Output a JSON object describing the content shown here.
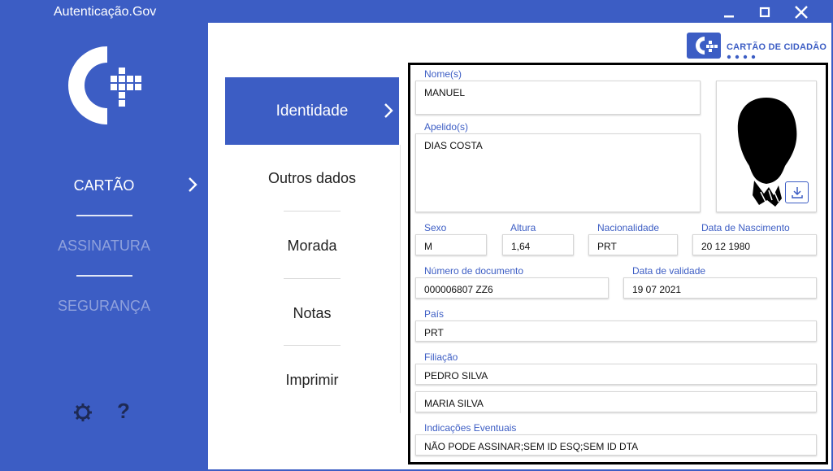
{
  "window": {
    "title": "Autenticação.Gov",
    "minimize_icon": "minimize-icon",
    "maximize_icon": "maximize-icon",
    "close_icon": "close-icon"
  },
  "colors": {
    "brand_blue": "#3c5dc4",
    "inactive_nav": "#8fa1dc",
    "label_blue": "#3c5dc4"
  },
  "sidebar": {
    "logo_icon": "cartao-cidadao-logo",
    "items": [
      {
        "label": "CARTÃO",
        "active": true
      },
      {
        "label": "ASSINATURA",
        "active": false
      },
      {
        "label": "SEGURANÇA",
        "active": false
      }
    ],
    "settings_icon": "gear-icon",
    "help_label": "?"
  },
  "brand": {
    "text": "CARTÃO DE CIDADÃO"
  },
  "subnav": {
    "items": [
      {
        "label": "Identidade",
        "active": true
      },
      {
        "label": "Outros dados"
      },
      {
        "label": "Morada"
      },
      {
        "label": "Notas"
      },
      {
        "label": "Imprimir"
      }
    ]
  },
  "card": {
    "nomes": {
      "label": "Nome(s)",
      "value": "MANUEL"
    },
    "apelidos": {
      "label": "Apelido(s)",
      "value": "DIAS COSTA"
    },
    "sexo": {
      "label": "Sexo",
      "value": "M"
    },
    "altura": {
      "label": "Altura",
      "value": "1,64"
    },
    "nacionalidade": {
      "label": "Nacionalidade",
      "value": "PRT"
    },
    "nascimento": {
      "label": "Data de Nascimento",
      "value": "20 12 1980"
    },
    "documento": {
      "label": "Número de documento",
      "value": "000006807 ZZ6"
    },
    "validade": {
      "label": "Data de validade",
      "value": "19 07 2021"
    },
    "pais": {
      "label": "País",
      "value": "PRT"
    },
    "filiacao": {
      "label": "Filiação",
      "pai": "PEDRO SILVA",
      "mae": "MARIA SILVA"
    },
    "indicacoes": {
      "label": "Indicações Eventuais",
      "value": "NÃO PODE ASSINAR;SEM ID ESQ;SEM ID DTA"
    },
    "photo_icon": "portrait-silhouette",
    "download_icon": "download-icon"
  }
}
